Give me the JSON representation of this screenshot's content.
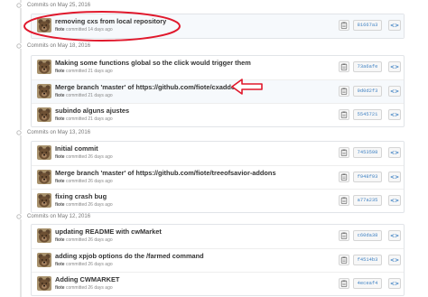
{
  "groups": [
    {
      "date_label": "Commits on May 25, 2016",
      "commits": [
        {
          "message": "removing cxs from local repository",
          "author": "fiote",
          "time": "committed 14 days ago",
          "sha": "81667a3"
        }
      ]
    },
    {
      "date_label": "Commits on May 18, 2016",
      "commits": [
        {
          "message": "Making some functions global so the click would trigger them",
          "author": "fiote",
          "time": "committed 21 days ago",
          "sha": "73a6afe"
        },
        {
          "message": "Merge branch 'master' of https://github.com/fiote/cxaddons",
          "author": "fiote",
          "time": "committed 21 days ago",
          "sha": "9d0d2f3"
        },
        {
          "message": "subindo alguns ajustes",
          "author": "fiote",
          "time": "committed 21 days ago",
          "sha": "5545721"
        }
      ]
    },
    {
      "date_label": "Commits on May 13, 2016",
      "commits": [
        {
          "message": "Initial commit",
          "author": "fiote",
          "time": "committed 26 days ago",
          "sha": "7453598"
        },
        {
          "message": "Merge branch 'master' of https://github.com/fiote/treeofsavior-addons",
          "author": "fiote",
          "time": "committed 26 days ago",
          "sha": "f948f93"
        },
        {
          "message": "fixing crash bug",
          "author": "fiote",
          "time": "committed 26 days ago",
          "sha": "a77a235"
        }
      ]
    },
    {
      "date_label": "Commits on May 12, 2016",
      "commits": [
        {
          "message": "updating README with cwMarket",
          "author": "fiote",
          "time": "committed 26 days ago",
          "sha": "c60da38"
        },
        {
          "message": "adding xpjob options do the /farmed command",
          "author": "fiote",
          "time": "committed 26 days ago",
          "sha": "f4514b3"
        },
        {
          "message": "Adding CWMARKET",
          "author": "fiote",
          "time": "committed 26 days ago",
          "sha": "4eceaf4"
        }
      ]
    }
  ],
  "browse_label": "<>",
  "icons": {
    "commit_dot": "commit-dot-icon",
    "copy": "clipboard-icon",
    "avatar": "bear-avatar",
    "annotation_ellipse": "red-ellipse",
    "annotation_arrow": "red-arrow"
  },
  "colors": {
    "link": "#4183c4",
    "annotation": "#e0182c",
    "timeline": "#e5e5e5"
  }
}
